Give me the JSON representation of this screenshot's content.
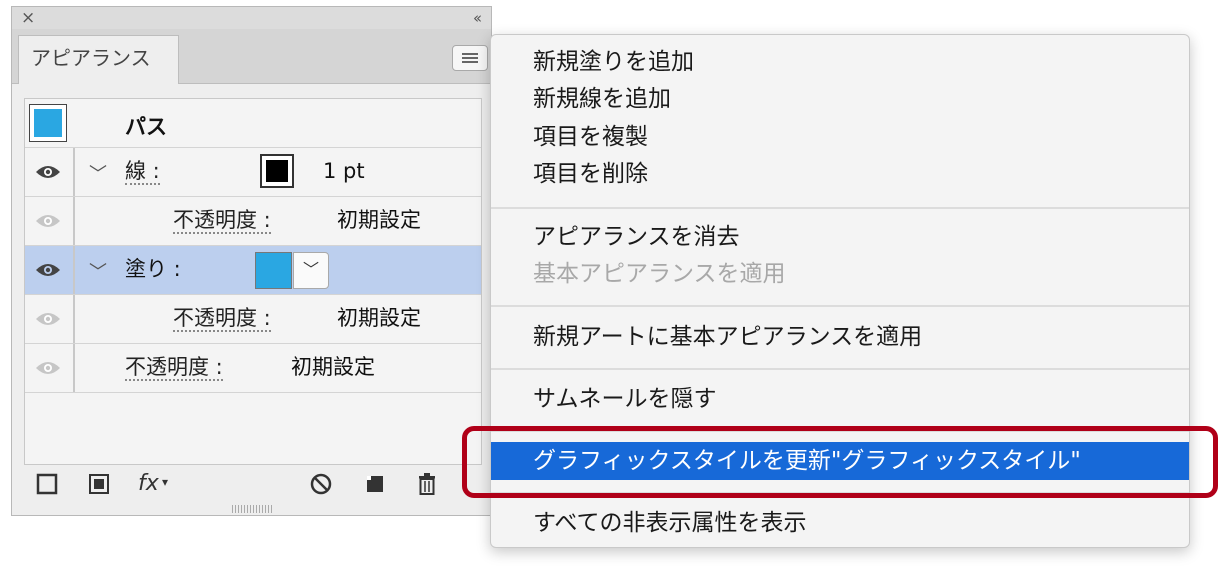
{
  "panel": {
    "tab_label": "アピアランス",
    "close_icon": "×",
    "collapse_icon": "‹‹",
    "rows": [
      {
        "kind": "header",
        "title": "パス",
        "swatch_color": "#2aa7e2"
      },
      {
        "kind": "stroke",
        "label": "線 :",
        "weight": "1 pt"
      },
      {
        "kind": "opacity",
        "label": "不透明度 :",
        "value": "初期設定"
      },
      {
        "kind": "fill",
        "label": "塗り :",
        "swatch_color": "#2aa7e2",
        "selected": true
      },
      {
        "kind": "opacity",
        "label": "不透明度 :",
        "value": "初期設定"
      },
      {
        "kind": "opacity",
        "label": "不透明度 :",
        "value": "初期設定"
      }
    ],
    "toolbar": {
      "fx_label": "fx"
    }
  },
  "menu": {
    "items": [
      {
        "label": "新規塗りを追加",
        "disabled": false
      },
      {
        "label": "新規線を追加",
        "disabled": false
      },
      {
        "label": "項目を複製",
        "disabled": false
      },
      {
        "label": "項目を削除",
        "disabled": false
      },
      {
        "label": "アピアランスを消去",
        "disabled": false
      },
      {
        "label": "基本アピアランスを適用",
        "disabled": true
      },
      {
        "label": "新規アートに基本アピアランスを適用",
        "disabled": false
      },
      {
        "label": "サムネールを隠す",
        "disabled": false
      },
      {
        "label": "グラフィックスタイルを更新\"グラフィックスタイル\"",
        "disabled": false,
        "highlighted": true
      },
      {
        "label": "すべての非表示属性を表示",
        "disabled": false
      }
    ]
  },
  "colors": {
    "highlight": "#1769d8",
    "callout": "#b00018",
    "swatch_blue": "#2aa7e2",
    "selected_row": "#bccfee"
  }
}
